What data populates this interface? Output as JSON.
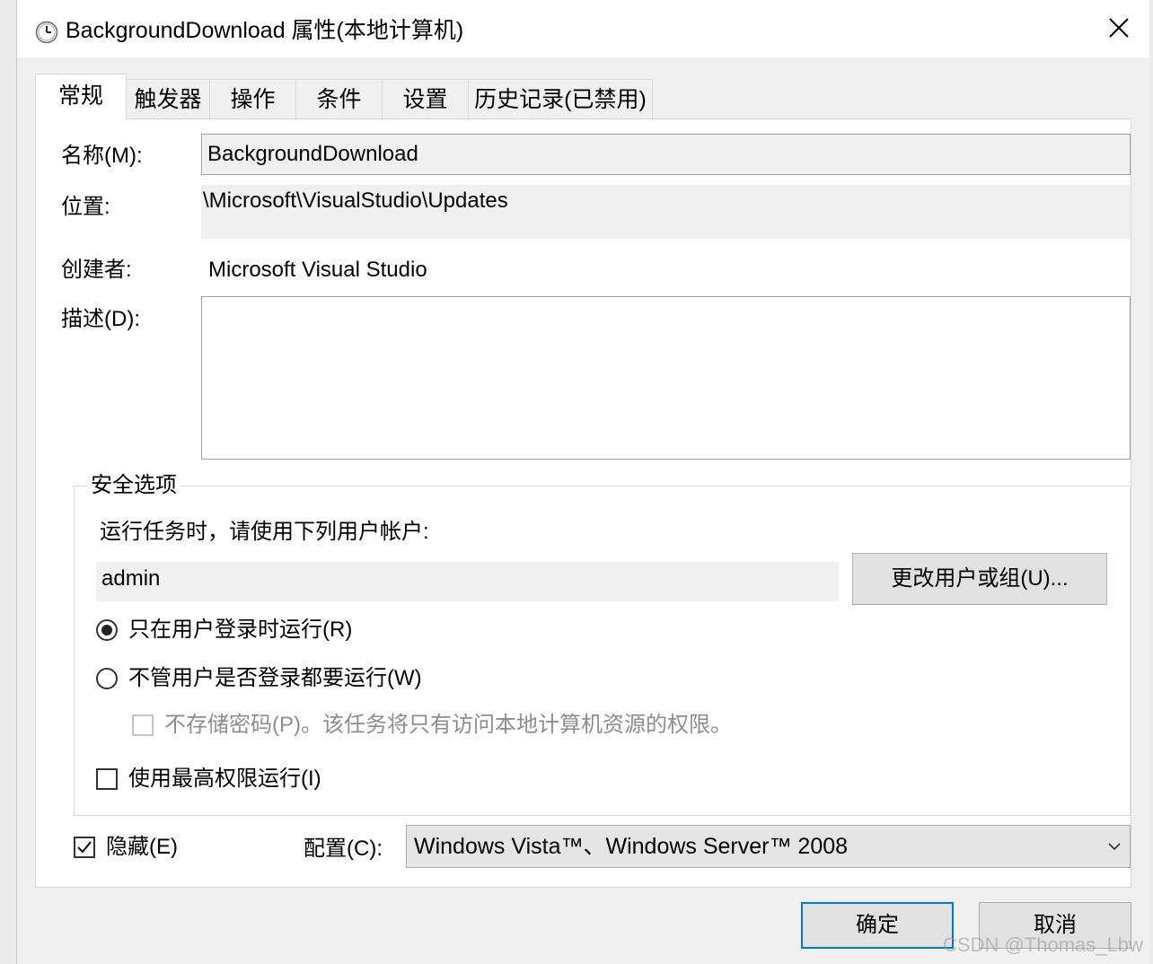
{
  "window": {
    "title": "BackgroundDownload 属性(本地计算机)",
    "icon": "clock-icon"
  },
  "tabs": [
    {
      "label": "常规",
      "active": true
    },
    {
      "label": "触发器"
    },
    {
      "label": "操作"
    },
    {
      "label": "条件"
    },
    {
      "label": "设置"
    },
    {
      "label": "历史记录(已禁用)"
    }
  ],
  "general": {
    "name_label": "名称(M):",
    "name_value": "BackgroundDownload",
    "location_label": "位置:",
    "location_value": "\\Microsoft\\VisualStudio\\Updates",
    "author_label": "创建者:",
    "author_value": "Microsoft Visual Studio",
    "description_label": "描述(D):",
    "description_value": ""
  },
  "security": {
    "group_title": "安全选项",
    "run_as_label": "运行任务时，请使用下列用户帐户:",
    "user_account": "admin",
    "change_user_button": "更改用户或组(U)...",
    "options": {
      "run_only_logged_on": {
        "label": "只在用户登录时运行(R)",
        "checked": true
      },
      "run_whether_logged_on": {
        "label": "不管用户是否登录都要运行(W)",
        "checked": false
      },
      "do_not_store_password": {
        "label": "不存储密码(P)。该任务将只有访问本地计算机资源的权限。",
        "checked": false,
        "disabled": true
      },
      "run_highest_privileges": {
        "label": "使用最高权限运行(I)",
        "checked": false
      }
    }
  },
  "hidden": {
    "label": "隐藏(E)",
    "checked": true
  },
  "configure": {
    "label": "配置(C):",
    "selected": "Windows Vista™、Windows Server™ 2008"
  },
  "footer": {
    "ok_button": "确定",
    "cancel_button": "取消"
  },
  "watermark": "CSDN @Thomas_Lbw",
  "colors": {
    "dialog_bg": "#f0f0f0",
    "panel_bg": "#ffffff",
    "field_bg": "#f0f0f0",
    "button_bg": "#e1e1e1",
    "focus_border": "#0078d7",
    "disabled_text": "#8d8d8d"
  }
}
